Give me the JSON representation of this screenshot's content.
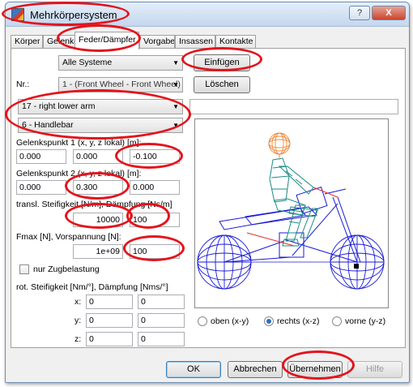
{
  "window": {
    "title": "Mehrkörpersystem",
    "help_label": "?",
    "close_label": "X"
  },
  "tabs": [
    {
      "label": "Körper"
    },
    {
      "label": "Gelenke"
    },
    {
      "label": "Feder/Dämpfer",
      "active": true
    },
    {
      "label": "Vorgaben"
    },
    {
      "label": "Insassen"
    },
    {
      "label": "Kontakte"
    }
  ],
  "top": {
    "system_select": "Alle Systeme",
    "insert_button": "Einfügen",
    "nr_label": "Nr.:",
    "nr_select": "1 - (Front Wheel - Front Wheel)",
    "delete_button": "Löschen",
    "body1_select": "17 - right lower arm",
    "body2_select": "6 - Handlebar"
  },
  "params": {
    "joint1_label": "Gelenkspunkt 1 (x, y, z lokal) [m]:",
    "joint1": [
      "0.000",
      "0.000",
      "-0.100"
    ],
    "joint2_label": "Gelenkspunkt 2 (x, y, z lokal) [m]:",
    "joint2": [
      "0.000",
      "0.300",
      "0.000"
    ],
    "stiffness_label": "transl. Steifigkeit [N/m], Dämpfung [Ns/m]",
    "stiffness": "10000",
    "damping": "100",
    "fmax_label": "Fmax [N], Vorspannung [N]:",
    "fmax": "1e+09",
    "preload": "100",
    "tension_only_label": "nur Zugbelastung",
    "rot_label": "rot. Steifigkeit [Nm/°], Dämpfung [Nms/°]",
    "rot_rows": [
      {
        "axis": "x:",
        "stiff": "0",
        "damp": "0"
      },
      {
        "axis": "y:",
        "stiff": "0",
        "damp": "0"
      },
      {
        "axis": "z:",
        "stiff": "0",
        "damp": "0"
      }
    ]
  },
  "view": {
    "options": [
      {
        "label": "oben (x-y)",
        "checked": false
      },
      {
        "label": "rechts (x-z)",
        "checked": true
      },
      {
        "label": "vorne (y-z)",
        "checked": false
      }
    ]
  },
  "buttons": {
    "ok": "OK",
    "cancel": "Abbrechen",
    "apply": "Übernehmen",
    "help": "Hilfe"
  },
  "colors": {
    "annotation": "#e3141c",
    "mesh_blue": "#1a1ad6",
    "rider_teal": "#1d8c86",
    "head_orange": "#f08a3a",
    "spring_red": "#e33030"
  }
}
